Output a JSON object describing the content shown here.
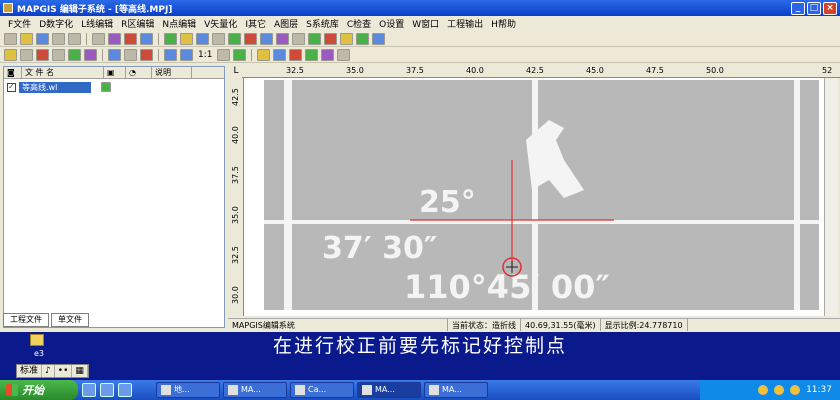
{
  "window": {
    "title": "MAPGIS 编辑子系统 - [等高线.MPJ]",
    "minimize": "_",
    "maximize": "□",
    "close": "×"
  },
  "menu": [
    "F文件",
    "D数字化",
    "L线编辑",
    "R区编辑",
    "N点编辑",
    "V矢量化",
    "I其它",
    "A图层",
    "S系统库",
    "C检查",
    "O设置",
    "W窗口",
    "工程输出",
    "H帮助"
  ],
  "toolbar": {
    "zoom_ratio": "1:1"
  },
  "left_panel": {
    "header": {
      "name_col": "文 件 名",
      "desc_col": "说明"
    },
    "rows": [
      {
        "name": "等高线.wl"
      }
    ],
    "tabs": [
      "工程文件",
      "单文件"
    ]
  },
  "ruler": {
    "corner": "L",
    "top_ticks": [
      "32.5",
      "35.0",
      "37.5",
      "40.0",
      "42.5",
      "45.0",
      "47.5",
      "50.0",
      "52"
    ],
    "left_ticks": [
      "42.5",
      "40.0",
      "37.5",
      "35.0",
      "32.5",
      "30.0"
    ]
  },
  "map": {
    "labels": [
      "25°",
      "37′ 30″",
      "110°45′ 00″"
    ]
  },
  "statusbar": {
    "app": "MAPGIS编辑系统",
    "state_label": "当前状态：",
    "state_value": "造折线",
    "coords": "40.69,31.55(毫米)",
    "scale_label": "显示比例:",
    "scale_value": "24.778710"
  },
  "caption": "在进行校正前要先标记好控制点",
  "desktop": {
    "icon_label": "e3"
  },
  "ime": [
    "标准",
    "♪",
    "••",
    "▦"
  ],
  "taskbar": {
    "start": "开始",
    "tasks": [
      "地...",
      "MA...",
      "Ca...",
      "MA...",
      "MA..."
    ],
    "clock": "11:37"
  },
  "colors": {
    "crosshair": "#e03030",
    "map_bg": "#b8b8b8",
    "title_blue": "#0a3fc8"
  }
}
